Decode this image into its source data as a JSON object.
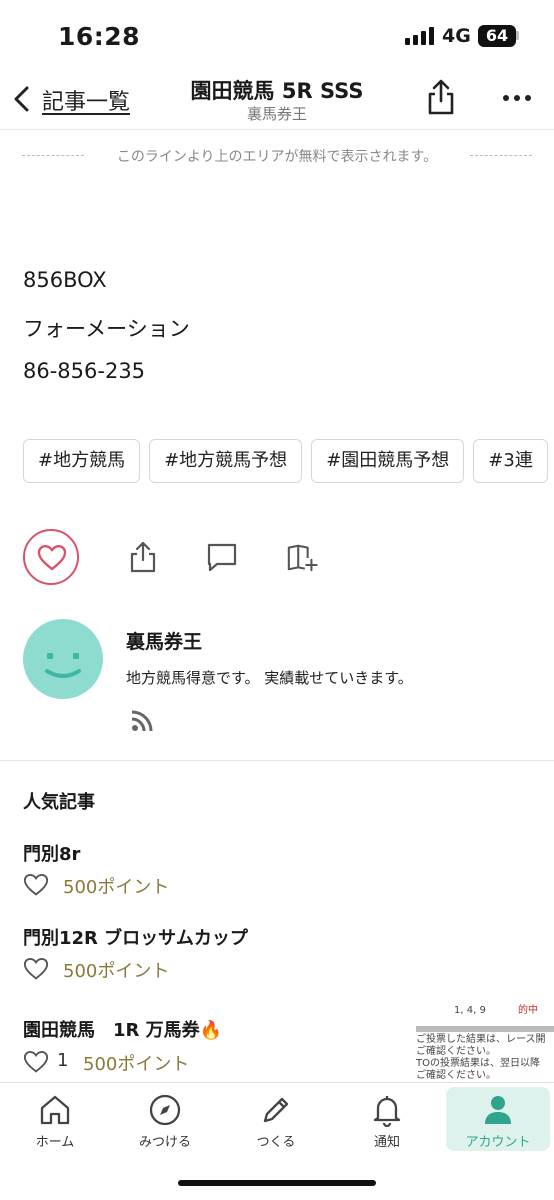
{
  "status_bar": {
    "time": "16:28",
    "network": "4G",
    "battery": "64"
  },
  "header": {
    "back_label": "記事一覧",
    "title": "園田競馬 5R SSS",
    "subtitle": "裏馬券王"
  },
  "free_line_text": "このラインより上のエリアが無料で表示されます。",
  "body_lines": [
    "856BOX",
    "フォーメーション",
    "86-856-235"
  ],
  "tags": [
    "#地方競馬",
    "#地方競馬予想",
    "#園田競馬予想",
    "#3連"
  ],
  "author": {
    "name": "裏馬券王",
    "bio": "地方競馬得意です。 実績載せていきます。"
  },
  "popular": {
    "title": "人気記事",
    "items": [
      {
        "title": "門別8r",
        "likes": "",
        "price": "500ポイント"
      },
      {
        "title": "門別12R ブロッサムカップ",
        "likes": "",
        "price": "500ポイント"
      },
      {
        "title": "園田競馬　1R 万馬券🔥",
        "likes": "1",
        "price": "500ポイント"
      }
    ]
  },
  "ad": {
    "line1": "1, 4, 9",
    "line1b": "的中",
    "line2": "ご投票した結果は、レース開",
    "line3": "ご確認ください。",
    "line4": "TOの投票結果は、翌日以降",
    "line5": "ご確認ください。"
  },
  "tabbar": {
    "items": [
      {
        "label": "ホーム",
        "icon": "home-icon"
      },
      {
        "label": "みつける",
        "icon": "compass-icon"
      },
      {
        "label": "つくる",
        "icon": "pencil-icon"
      },
      {
        "label": "通知",
        "icon": "bell-icon"
      },
      {
        "label": "アカウント",
        "icon": "person-icon"
      }
    ]
  },
  "colors": {
    "like": "#d9536b",
    "avatar": "#8edcd0",
    "price": "#8a7a3a",
    "accent": "#2fa58d"
  }
}
